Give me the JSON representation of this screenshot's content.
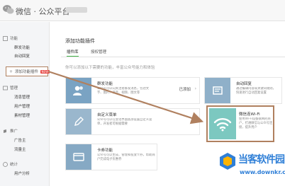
{
  "header": {
    "brand": "微信 · 公众平台"
  },
  "sidebar": {
    "groups": [
      {
        "label": "功能",
        "icon": "function-icon",
        "items": [
          "群发功能",
          "自动回复"
        ]
      },
      {
        "label": "管理",
        "icon": "manage-icon",
        "items": [
          "消息管理",
          "用户管理",
          "素材管理"
        ]
      },
      {
        "label": "推广",
        "icon": "promote-icon",
        "items": [
          "广告主",
          "流量主"
        ]
      },
      {
        "label": "统计",
        "icon": "stats-icon",
        "items": [
          "用户分析"
        ]
      }
    ],
    "add_plugin": {
      "label": "添加功能插件",
      "badge": "NEW"
    }
  },
  "main": {
    "title": "添加功能插件",
    "tabs": [
      {
        "label": "插件库",
        "active": true
      },
      {
        "label": "授权管理",
        "active": false
      }
    ],
    "notice": "你可以添加以下需要的功能，丰富公众号能力和体验",
    "cards": [
      {
        "title": "群发功能",
        "desc": "公众号可以向关注者群发消息，包括文字、图片、语音、视频、图文等",
        "status": "已添加",
        "icon": "users-icon"
      },
      {
        "title": "自动回复",
        "desc": "通过编辑内容或关键词规则，快速进行自动回复设置",
        "status": "",
        "icon": "reply-icon"
      },
      {
        "title": "自定义菜单",
        "desc": "公众号可以在会话界面底部设置自定义菜单，开发者可根据需要",
        "status": "",
        "icon": "edit-icon"
      },
      {
        "title": "卡券功能",
        "desc": "公众号可以生成、管理和投放卡券，帮助商户完成电子优惠券",
        "status": "",
        "icon": "card-icon"
      }
    ],
    "wifi_card": {
      "title": "微信连Wi-Fi",
      "desc": "使用Wi-Fi设备联网的商户，打通微信与公众号连接，提升用户",
      "icon": "wifi-icon"
    }
  },
  "watermark": {
    "title": "当客软件园",
    "url": "www.downkr.com"
  },
  "colors": {
    "accent_green": "#44b549",
    "annotation_brown": "#b0805f",
    "card_blue": "#7aa3c3",
    "wifi_teal": "#7cc8c0",
    "watermark_blue": "#2f7fd7"
  }
}
